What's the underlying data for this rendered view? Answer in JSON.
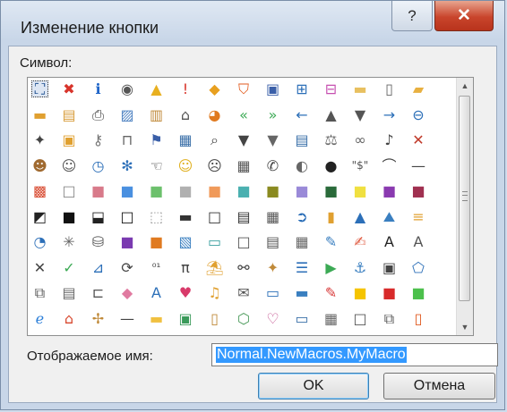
{
  "dialog": {
    "title": "Изменение кнопки",
    "help_glyph": "?",
    "close_glyph": "✕"
  },
  "symbol_label": "Символ:",
  "display_name": {
    "label": "Отображаемое имя:",
    "value": "Normal.NewMacros.MyMacro"
  },
  "buttons": {
    "ok": "OK",
    "cancel": "Отмена"
  },
  "scrollbar": {
    "up": "▲",
    "down": "▼"
  },
  "icons": [
    [
      [
        "network-icon",
        "⛶",
        "#1d4e8f"
      ],
      [
        "error-icon",
        "✖",
        "#d8342b"
      ],
      [
        "info-icon",
        "ℹ",
        "#1e64c8"
      ],
      [
        "record-icon",
        "◉",
        "#555555"
      ],
      [
        "warning-icon",
        "▲",
        "#e8b020"
      ],
      [
        "alert-icon",
        "!",
        "#d8342b"
      ],
      [
        "diamond-warning-icon",
        "◆",
        "#e8a020"
      ],
      [
        "shield-icon",
        "⛉",
        "#e25a1c"
      ],
      [
        "save-icon",
        "▣",
        "#3a5fa8"
      ],
      [
        "org-chart-icon",
        "⊞",
        "#2c6fb8"
      ],
      [
        "hierarchy-icon",
        "⊟",
        "#c64fb0"
      ],
      [
        "folder-icon",
        "▬",
        "#e8c060"
      ],
      [
        "page-icon",
        "▯",
        "#666666"
      ],
      [
        "open-folder-icon",
        "▰",
        "#e8b040"
      ]
    ],
    [
      [
        "folders-icon",
        "▬",
        "#e0a030"
      ],
      [
        "cabinet-icon",
        "▤",
        "#d89c3a"
      ],
      [
        "printer-icon",
        "⎙",
        "#444444"
      ],
      [
        "picture-icon",
        "▨",
        "#4a7fc0"
      ],
      [
        "paste-icon",
        "▥",
        "#c08a3a"
      ],
      [
        "home-icon",
        "⌂",
        "#555555"
      ],
      [
        "pie-icon",
        "◕",
        "#e07a20"
      ],
      [
        "rewind-icon",
        "«",
        "#3caa55"
      ],
      [
        "forward-icon",
        "»",
        "#3caa55"
      ],
      [
        "left-arrow-icon",
        "←",
        "#2c6fb8"
      ],
      [
        "up-arrow-icon",
        "▲",
        "#555555"
      ],
      [
        "down-arrow-icon",
        "▼",
        "#555555"
      ],
      [
        "right-arrow-icon",
        "→",
        "#2c6fb8"
      ],
      [
        "back-circle-icon",
        "⊖",
        "#2c6fb8"
      ]
    ],
    [
      [
        "pin-icon",
        "✦",
        "#444444"
      ],
      [
        "lock-icon",
        "▣",
        "#e0a030"
      ],
      [
        "key-icon",
        "⚷",
        "#777777"
      ],
      [
        "door-icon",
        "⊓",
        "#666666"
      ],
      [
        "flag-icon",
        "⚑",
        "#3a5fa8"
      ],
      [
        "calendar-icon",
        "▦",
        "#3a6fa8"
      ],
      [
        "zoom-icon",
        "⌕",
        "#444444"
      ],
      [
        "funnel-icon",
        "▼",
        "#444444"
      ],
      [
        "filter-icon",
        "▼",
        "#666666"
      ],
      [
        "book-icon",
        "▤",
        "#3a6fa8"
      ],
      [
        "scales-icon",
        "⚖",
        "#666666"
      ],
      [
        "link-icon",
        "∞",
        "#666666"
      ],
      [
        "mic-icon",
        "♪",
        "#444444"
      ],
      [
        "mute-icon",
        "✕",
        "#c03a2a"
      ]
    ],
    [
      [
        "user-icon",
        "☻",
        "#a06a30"
      ],
      [
        "person-icon",
        "☺",
        "#555555"
      ],
      [
        "clock-icon",
        "◷",
        "#2c6fb8"
      ],
      [
        "snow-icon",
        "✻",
        "#2c6fb8"
      ],
      [
        "hand-icon",
        "☜",
        "#444444"
      ],
      [
        "smiley-icon",
        "☺",
        "#e0b020"
      ],
      [
        "sad-icon",
        "☹",
        "#444444"
      ],
      [
        "calculator-icon",
        "▦",
        "#555555"
      ],
      [
        "phone-icon",
        "✆",
        "#444444"
      ],
      [
        "piggy-icon",
        "◐",
        "#666666"
      ],
      [
        "eight-ball-icon",
        "●",
        "#222222"
      ],
      [
        "quotes-icon",
        "\"$\"",
        "#555555"
      ],
      [
        "signal-icon",
        "⌒",
        "#444444"
      ],
      [
        "dash-icon",
        "—",
        "#444444"
      ]
    ],
    [
      [
        "palette-icon",
        "▩",
        "#d84a30"
      ],
      [
        "white-square-icon",
        "□",
        "#888888"
      ],
      [
        "pink-square-icon",
        "■",
        "#d87a8a"
      ],
      [
        "blue-square-icon",
        "■",
        "#4a90e0"
      ],
      [
        "green-square-icon",
        "■",
        "#6cc06c"
      ],
      [
        "grey-square-icon",
        "■",
        "#b0b0b0"
      ],
      [
        "orange-square-icon",
        "■",
        "#f09a5a"
      ],
      [
        "teal-square-icon",
        "■",
        "#4ab0b0"
      ],
      [
        "olive-square-icon",
        "■",
        "#8a8a20"
      ],
      [
        "lavender-square-icon",
        "■",
        "#9a8ad8"
      ],
      [
        "darkgreen-square-icon",
        "■",
        "#2a6a3a"
      ],
      [
        "yellow-square-icon",
        "■",
        "#f0e040"
      ],
      [
        "purple-square-icon",
        "■",
        "#8a3ab0"
      ],
      [
        "maroon-square-icon",
        "■",
        "#a03050"
      ]
    ],
    [
      [
        "diagonal-fill-icon",
        "◩",
        "#222222"
      ],
      [
        "black-square-icon",
        "■",
        "#111111"
      ],
      [
        "half-fill-icon",
        "⬓",
        "#222222"
      ],
      [
        "outline-square-icon",
        "□",
        "#111111"
      ],
      [
        "dotted-square-icon",
        "⬚",
        "#999999"
      ],
      [
        "bar-fill-icon",
        "▬",
        "#333333"
      ],
      [
        "frame-icon",
        "□",
        "#333333"
      ],
      [
        "stripe-fill-icon",
        "▤",
        "#333333"
      ],
      [
        "grid-fill-icon",
        "▦",
        "#555555"
      ],
      [
        "arrow-circle-icon",
        "➲",
        "#2c6fb8"
      ],
      [
        "bar-chart-icon",
        "▮",
        "#e0a030"
      ],
      [
        "triangle-icon",
        "▲",
        "#2c6fb8"
      ],
      [
        "mountain-icon",
        "⛰",
        "#3a7fc0"
      ],
      [
        "align-icon",
        "≡",
        "#e0a030"
      ]
    ],
    [
      [
        "pie-chart-icon",
        "◔",
        "#2c6fb8"
      ],
      [
        "radar-icon",
        "✳",
        "#666666"
      ],
      [
        "database-icon",
        "⛁",
        "#555555"
      ],
      [
        "purple-box-icon",
        "■",
        "#7a3ab0"
      ],
      [
        "orange-box-icon",
        "■",
        "#e07a20"
      ],
      [
        "image-edit-icon",
        "▧",
        "#3a7fc0"
      ],
      [
        "gradient-icon",
        "▭",
        "#3aa0a0"
      ],
      [
        "blank-box-icon",
        "□",
        "#555555"
      ],
      [
        "list-box-icon",
        "▤",
        "#555555"
      ],
      [
        "table-icon",
        "▦",
        "#666666"
      ],
      [
        "brush-icon",
        "✎",
        "#3a7fc0"
      ],
      [
        "pen-icon",
        "✍",
        "#e05a40"
      ],
      [
        "text-a-icon",
        "A",
        "#222222"
      ],
      [
        "shaded-a-icon",
        "A",
        "#555555"
      ]
    ],
    [
      [
        "cross-icon",
        "✕",
        "#444444"
      ],
      [
        "check-icon",
        "✓",
        "#3caa55"
      ],
      [
        "chart-icon",
        "⊿",
        "#2c6fb8"
      ],
      [
        "refresh-icon",
        "⟳",
        "#444444"
      ],
      [
        "binary-icon",
        "⁰¹",
        "#444444"
      ],
      [
        "pi-icon",
        "π",
        "#444444"
      ],
      [
        "paint-bucket-icon",
        "⛱",
        "#e0a030"
      ],
      [
        "binoculars-icon",
        "⚯",
        "#444444"
      ],
      [
        "magic-wand-icon",
        "✦",
        "#c08a3a"
      ],
      [
        "list-bullets-icon",
        "☰",
        "#2c6fb8"
      ],
      [
        "play-icon",
        "▶",
        "#3caa55"
      ],
      [
        "anchor-icon",
        "⚓",
        "#3a7fc0"
      ],
      [
        "briefcase-icon",
        "▣",
        "#444444"
      ],
      [
        "shape-add-icon",
        "⬠",
        "#2c6fb8"
      ]
    ],
    [
      [
        "copy-icon",
        "⧉",
        "#555555"
      ],
      [
        "form-icon",
        "▤",
        "#666666"
      ],
      [
        "tray-icon",
        "⊏",
        "#555555"
      ],
      [
        "eraser-icon",
        "◆",
        "#e07aa0"
      ],
      [
        "font-a-icon",
        "A",
        "#2c6fb8"
      ],
      [
        "heart-color-icon",
        "♥",
        "#d83a6a"
      ],
      [
        "bell-icon",
        "♫",
        "#e0a030"
      ],
      [
        "mail-open-icon",
        "✉",
        "#555555"
      ],
      [
        "card-icon",
        "▭",
        "#2c6fb8"
      ],
      [
        "window-icon",
        "▬",
        "#3a7fc0"
      ],
      [
        "edit-doc-icon",
        "✎",
        "#d83a3a"
      ],
      [
        "yellow-fill-icon",
        "■",
        "#f5c400"
      ],
      [
        "red-hatch-icon",
        "■",
        "#d82a2a"
      ],
      [
        "green-fill-icon",
        "■",
        "#4cc04c"
      ]
    ],
    [
      [
        "ie-icon",
        "ℯ",
        "#2c7fd8"
      ],
      [
        "home-blue-icon",
        "⌂",
        "#d84a30"
      ],
      [
        "signpost-icon",
        "✢",
        "#c08a3a"
      ],
      [
        "line-icon",
        "—",
        "#444444"
      ],
      [
        "sticky-note-icon",
        "▬",
        "#f0c040"
      ],
      [
        "photo-icon",
        "▣",
        "#3a9a5a"
      ],
      [
        "clipboard-icon",
        "▯",
        "#c08a3a"
      ],
      [
        "cube-icon",
        "⬡",
        "#4a9a5a"
      ],
      [
        "heart-link-icon",
        "♡",
        "#c04a8a"
      ],
      [
        "presentation-icon",
        "▭",
        "#3a6fa8"
      ],
      [
        "grid-table-icon",
        "▦",
        "#666666"
      ],
      [
        "frame-window-icon",
        "□",
        "#555555"
      ],
      [
        "multi-window-icon",
        "⧉",
        "#555555"
      ],
      [
        "doc-check-icon",
        "▯",
        "#e05a20"
      ]
    ]
  ]
}
